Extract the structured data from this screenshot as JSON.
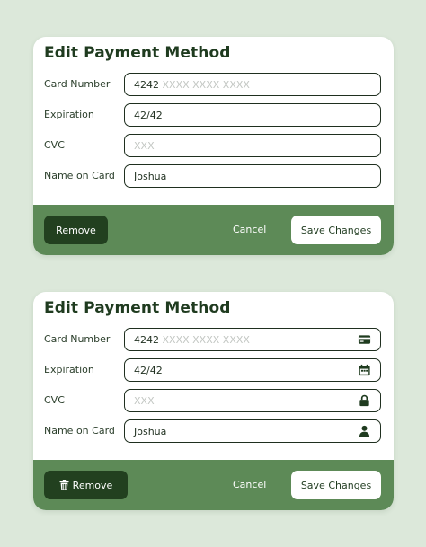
{
  "cards": [
    {
      "title": "Edit Payment Method",
      "fields": [
        {
          "label": "Card Number",
          "value": "4242",
          "placeholder": "XXXX XXXX XXXX",
          "icon": ""
        },
        {
          "label": "Expiration",
          "value": "42/42",
          "placeholder": "",
          "icon": ""
        },
        {
          "label": "CVC",
          "value": "",
          "placeholder": "XXX",
          "icon": ""
        },
        {
          "label": "Name on Card",
          "value": "Joshua",
          "placeholder": "",
          "icon": ""
        }
      ],
      "footer": {
        "remove_label": "Remove",
        "remove_icon": "",
        "cancel_label": "Cancel",
        "save_label": "Save Changes"
      }
    },
    {
      "title": "Edit Payment Method",
      "fields": [
        {
          "label": "Card Number",
          "value": "4242",
          "placeholder": "XXXX XXXX XXXX",
          "icon": "credit-card-icon"
        },
        {
          "label": "Expiration",
          "value": "42/42",
          "placeholder": "",
          "icon": "calendar-icon"
        },
        {
          "label": "CVC",
          "value": "",
          "placeholder": "XXX",
          "icon": "lock-icon"
        },
        {
          "label": "Name on Card",
          "value": "Joshua",
          "placeholder": "",
          "icon": "user-icon"
        }
      ],
      "footer": {
        "remove_label": "Remove",
        "remove_icon": "trash-icon",
        "cancel_label": "Cancel",
        "save_label": "Save Changes"
      }
    }
  ],
  "colors": {
    "background": "#dce8da",
    "card": "#ffffff",
    "footer": "#5d8a57",
    "remove_button": "#22401f",
    "text_dark": "#1f3b1f",
    "placeholder": "#c3c7c3"
  }
}
